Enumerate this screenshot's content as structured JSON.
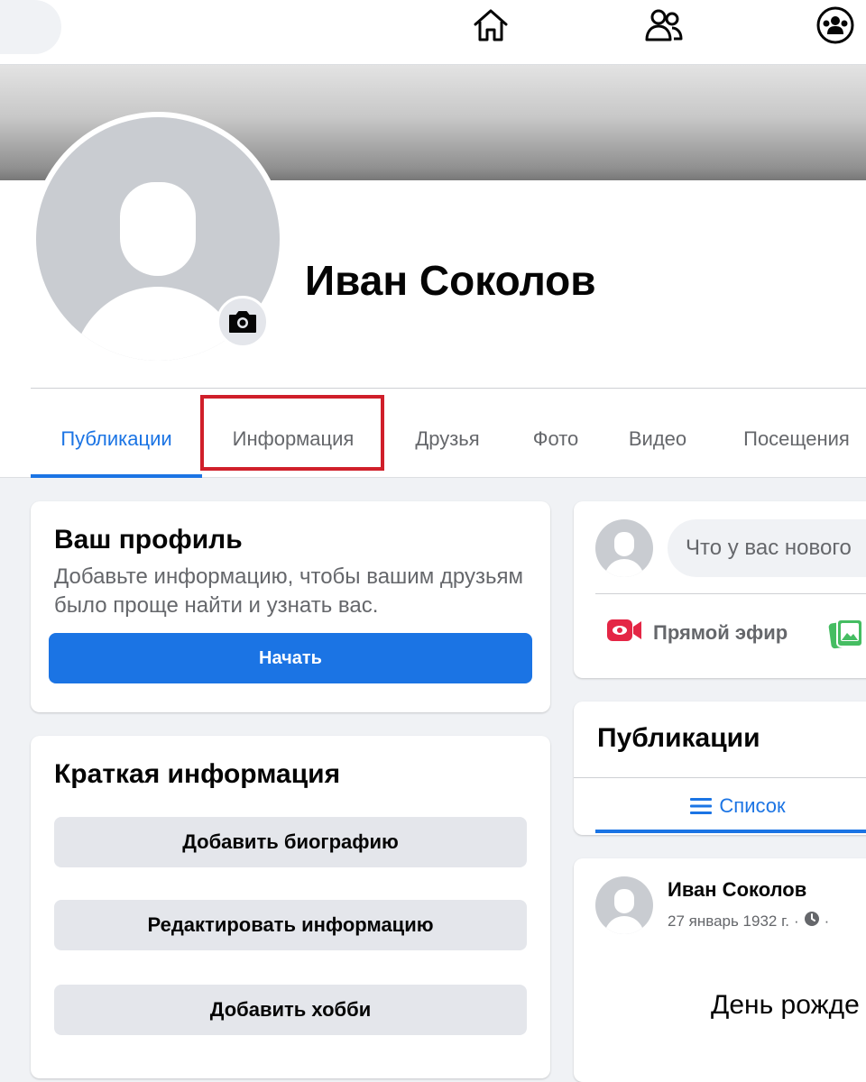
{
  "profile": {
    "name": "Иван Соколов"
  },
  "tabs": [
    {
      "label": "Публикации",
      "active": true
    },
    {
      "label": "Информация",
      "active": false
    },
    {
      "label": "Друзья",
      "active": false
    },
    {
      "label": "Фото",
      "active": false
    },
    {
      "label": "Видео",
      "active": false
    },
    {
      "label": "Посещения",
      "active": false
    }
  ],
  "your_profile": {
    "title": "Ваш профиль",
    "text": "Добавьте информацию, чтобы вашим друзьям было проще найти и узнать вас.",
    "button": "Начать"
  },
  "intro": {
    "title": "Краткая информация",
    "buttons": [
      "Добавить биографию",
      "Редактировать информацию",
      "Добавить хобби"
    ]
  },
  "composer": {
    "placeholder": "Что у вас нового",
    "live_label": "Прямой эфир"
  },
  "posts": {
    "title": "Публикации",
    "list_tab": "Список"
  },
  "post": {
    "author": "Иван Соколов",
    "date": "27 январь 1932 г.",
    "body": "День рожде"
  },
  "colors": {
    "accent": "#1b74e4",
    "highlight": "#d01f2a",
    "live": "#e42645",
    "photo": "#45bd62"
  }
}
